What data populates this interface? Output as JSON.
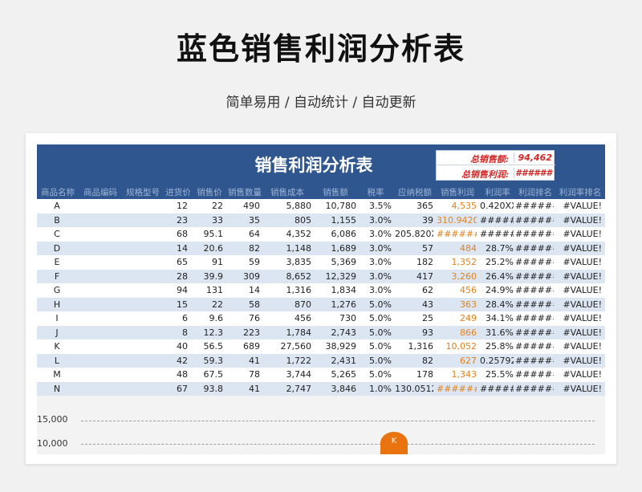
{
  "page": {
    "title": "蓝色销售利润分析表",
    "subtitle": "简单易用 / 自动统计 / 自动更新"
  },
  "sheet": {
    "title": "销售利润分析表",
    "summary": {
      "total_sales_label": "总销售额:",
      "total_sales_value": "94,462",
      "total_profit_label": "总销售利润:",
      "total_profit_value": "######"
    },
    "columns": [
      "商品名称",
      "商品编码",
      "规格型号",
      "进货价",
      "销售价",
      "销售数量",
      "销售成本",
      "销售额",
      "税率",
      "应纳税额",
      "销售利润",
      "利润率",
      "利润排名",
      "利润率排名"
    ],
    "rows": [
      [
        "A",
        "",
        "",
        "12",
        "22",
        "490",
        "5,880",
        "10,780",
        "3.5%",
        "365",
        "4,535",
        "0.420XX",
        "#######",
        "#VALUE!"
      ],
      [
        "B",
        "",
        "",
        "23",
        "33",
        "35",
        "805",
        "1,155",
        "3.0%",
        "39",
        "310.94207",
        "#####",
        "#######",
        "#VALUE!"
      ],
      [
        "C",
        "",
        "",
        "68",
        "95.1",
        "64",
        "4,352",
        "6,086",
        "3.0%",
        "205.820XX",
        "#######",
        "#####",
        "#######",
        "#VALUE!"
      ],
      [
        "D",
        "",
        "",
        "14",
        "20.6",
        "82",
        "1,148",
        "1,689",
        "3.0%",
        "57",
        "484",
        "28.7%",
        "#######",
        "#VALUE!"
      ],
      [
        "E",
        "",
        "",
        "65",
        "91",
        "59",
        "3,835",
        "5,369",
        "3.0%",
        "182",
        "1,352",
        "25.2%",
        "#######",
        "#VALUE!"
      ],
      [
        "F",
        "",
        "",
        "28",
        "39.9",
        "309",
        "8,652",
        "12,329",
        "3.0%",
        "417",
        "3,260",
        "26.4%",
        "#######",
        "#VALUE!"
      ],
      [
        "G",
        "",
        "",
        "94",
        "131",
        "14",
        "1,316",
        "1,834",
        "3.0%",
        "62",
        "456",
        "24.9%",
        "#######",
        "#VALUE!"
      ],
      [
        "H",
        "",
        "",
        "15",
        "22",
        "58",
        "870",
        "1,276",
        "5.0%",
        "43",
        "363",
        "28.4%",
        "#######",
        "#VALUE!"
      ],
      [
        "I",
        "",
        "",
        "6",
        "9.6",
        "76",
        "456",
        "730",
        "5.0%",
        "25",
        "249",
        "34.1%",
        "#######",
        "#VALUE!"
      ],
      [
        "J",
        "",
        "",
        "8",
        "12.3",
        "223",
        "1,784",
        "2,743",
        "5.0%",
        "93",
        "866",
        "31.6%",
        "#######",
        "#VALUE!"
      ],
      [
        "K",
        "",
        "",
        "40",
        "56.5",
        "689",
        "27,560",
        "38,929",
        "5.0%",
        "1,316",
        "10,052",
        "25.8%",
        "#######",
        "#VALUE!"
      ],
      [
        "L",
        "",
        "",
        "42",
        "59.3",
        "41",
        "1,722",
        "2,431",
        "5.0%",
        "82",
        "627",
        "0.25792",
        "#######",
        "#VALUE!"
      ],
      [
        "M",
        "",
        "",
        "48",
        "67.5",
        "78",
        "3,744",
        "5,265",
        "5.0%",
        "178",
        "1,343",
        "25.5%",
        "#######",
        "#VALUE!"
      ],
      [
        "N",
        "",
        "",
        "67",
        "93.8",
        "41",
        "2,747",
        "3,846",
        "1.0%",
        "130.05120",
        "#######",
        "#####",
        "#######",
        "#VALUE!"
      ]
    ]
  },
  "chart": {
    "y_ticks": [
      "15,000",
      "10,000"
    ],
    "marker_label": "K"
  },
  "colors": {
    "header_blue": "#2f568f",
    "row_alt": "#dce6f3",
    "profit_orange": "#e0821e",
    "summary_red": "#d32828"
  }
}
